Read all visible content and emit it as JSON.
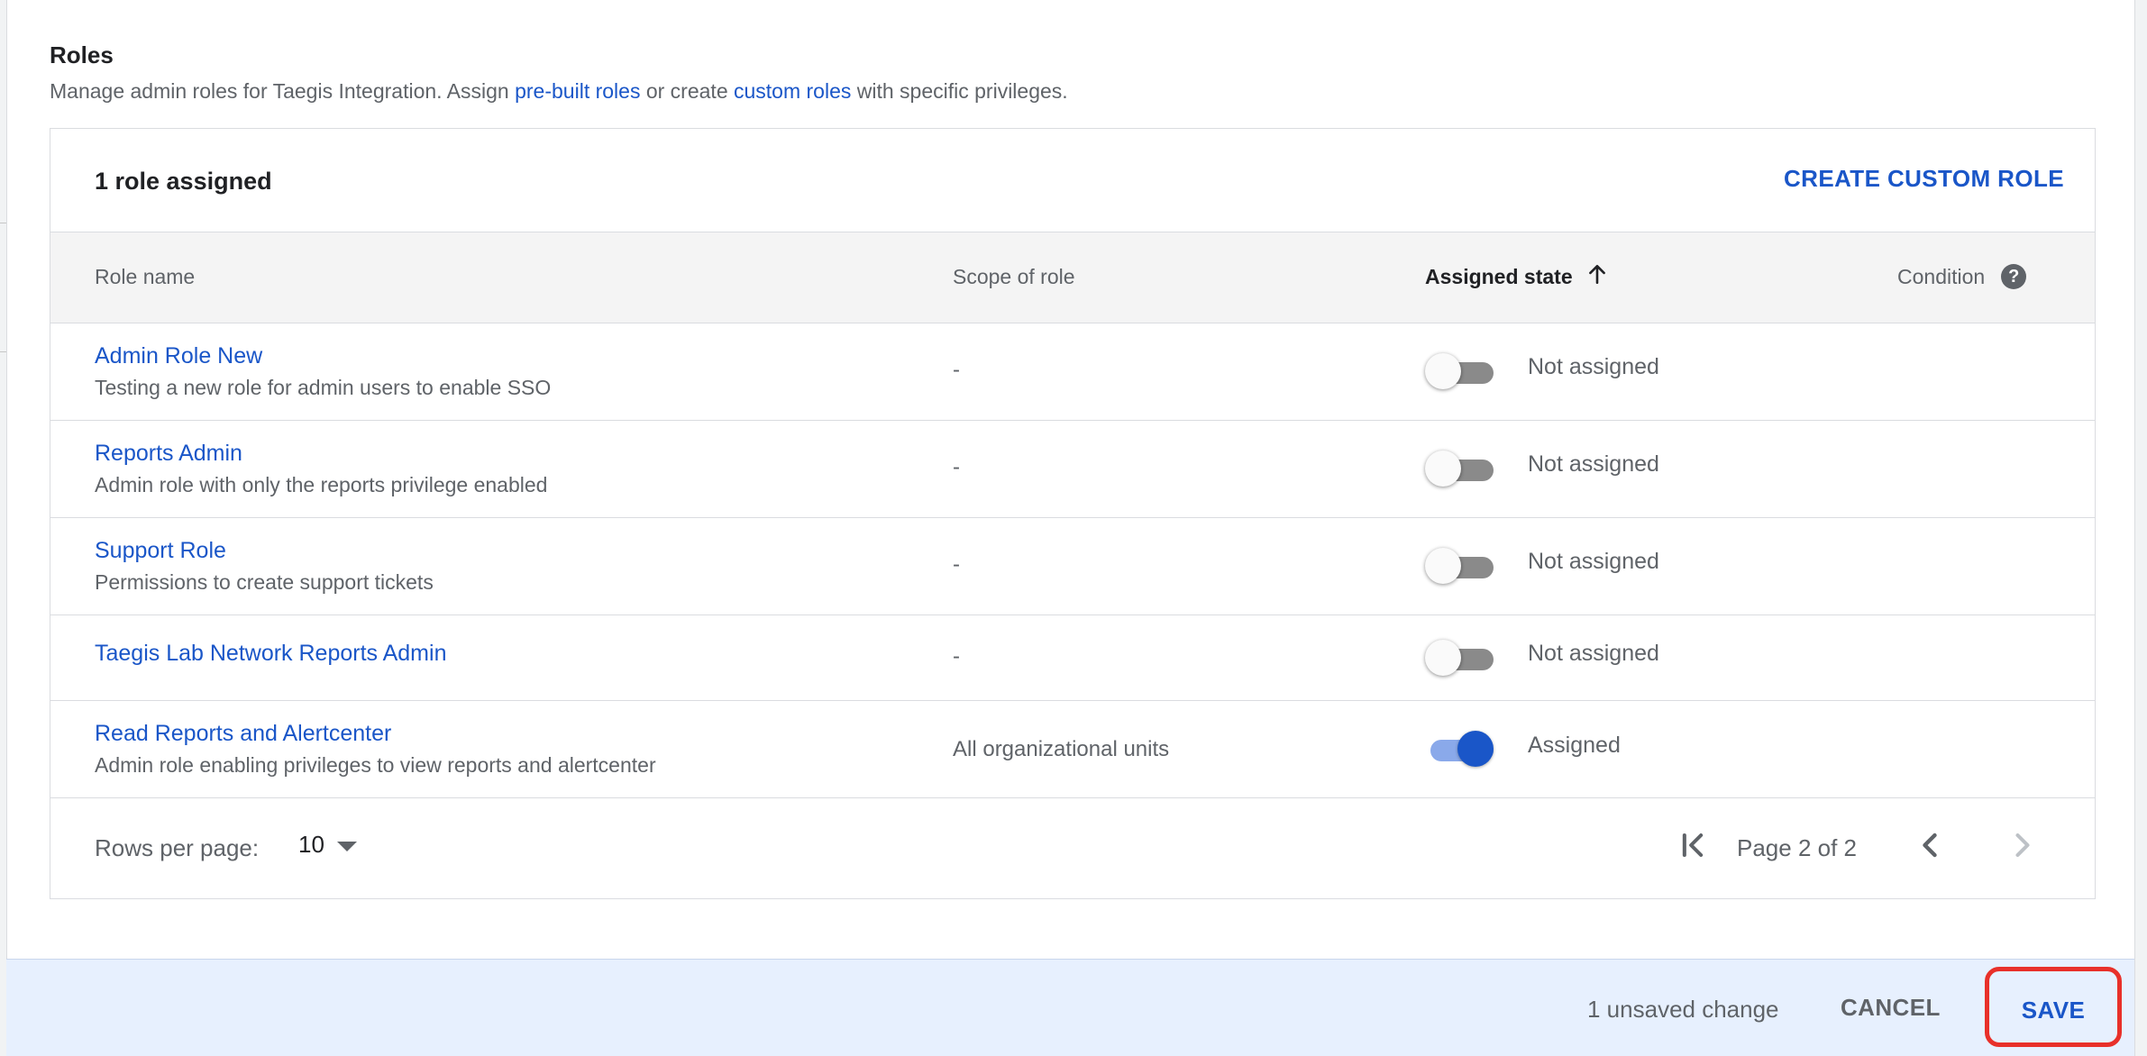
{
  "section": {
    "title": "Roles",
    "desc_prefix": "Manage admin roles for Taegis Integration. Assign ",
    "prebuilt_link": "pre-built roles",
    "desc_middle": " or create ",
    "custom_link": "custom roles",
    "desc_suffix": " with specific privileges."
  },
  "card": {
    "count_label": "1 role assigned",
    "create_button": "CREATE CUSTOM ROLE"
  },
  "table": {
    "columns": {
      "role_name": "Role name",
      "scope": "Scope of role",
      "assigned_state": "Assigned state",
      "condition": "Condition"
    },
    "sort": {
      "column": "assigned_state",
      "direction": "ascending",
      "icon": "arrow-up-icon"
    },
    "rows": [
      {
        "name": "Admin Role New",
        "description": "Testing a new role for admin users to enable SSO",
        "scope": "-",
        "assigned": false,
        "state_label": "Not assigned"
      },
      {
        "name": "Reports Admin",
        "description": "Admin role with only the reports privilege enabled",
        "scope": "-",
        "assigned": false,
        "state_label": "Not assigned"
      },
      {
        "name": "Support Role",
        "description": "Permissions to create support tickets",
        "scope": "-",
        "assigned": false,
        "state_label": "Not assigned"
      },
      {
        "name": "Taegis Lab Network Reports Admin",
        "description": "",
        "scope": "-",
        "assigned": false,
        "state_label": "Not assigned"
      },
      {
        "name": "Read Reports and Alertcenter",
        "description": "Admin role enabling privileges to view reports and alertcenter",
        "scope": "All organizational units",
        "assigned": true,
        "state_label": "Assigned"
      }
    ]
  },
  "pagination": {
    "rows_per_page_label": "Rows per page:",
    "rows_per_page_value": "10",
    "page_text": "Page 2 of 2"
  },
  "bottom_bar": {
    "unsaved_text": "1 unsaved change",
    "cancel_label": "CANCEL",
    "save_label": "SAVE"
  },
  "colors": {
    "link_blue": "#1a56c8",
    "highlight_red": "#e8302a",
    "bar_background": "#e7f0fe"
  }
}
